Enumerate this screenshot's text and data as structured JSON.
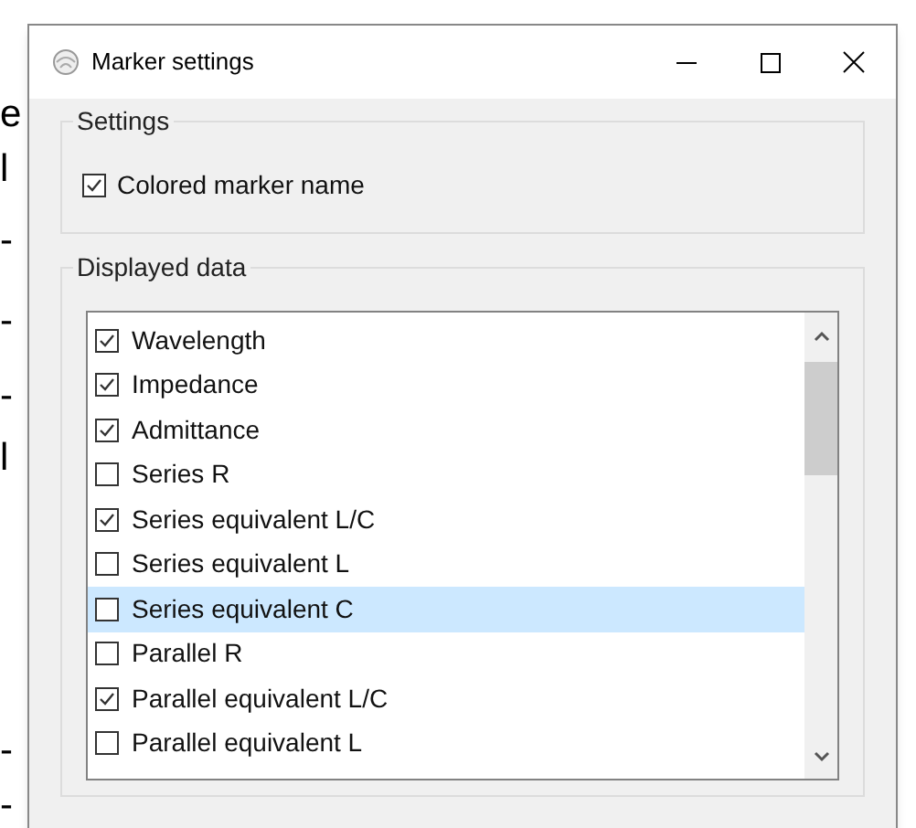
{
  "background_fragments": [
    "e",
    "l",
    "-",
    "-",
    "-",
    "l",
    "-",
    "-"
  ],
  "window": {
    "title": "Marker settings"
  },
  "settings_group": {
    "title": "Settings",
    "options": [
      {
        "label": "Colored marker name",
        "checked": true
      }
    ]
  },
  "displayed_data_group": {
    "title": "Displayed data",
    "items": [
      {
        "label": "Wavelength",
        "checked": true,
        "selected": false
      },
      {
        "label": "Impedance",
        "checked": true,
        "selected": false
      },
      {
        "label": "Admittance",
        "checked": true,
        "selected": false
      },
      {
        "label": "Series R",
        "checked": false,
        "selected": false
      },
      {
        "label": "Series equivalent L/C",
        "checked": true,
        "selected": false
      },
      {
        "label": "Series equivalent L",
        "checked": false,
        "selected": false
      },
      {
        "label": "Series equivalent C",
        "checked": false,
        "selected": true
      },
      {
        "label": "Parallel R",
        "checked": false,
        "selected": false
      },
      {
        "label": "Parallel equivalent L/C",
        "checked": true,
        "selected": false
      },
      {
        "label": "Parallel equivalent L",
        "checked": false,
        "selected": false
      }
    ]
  }
}
